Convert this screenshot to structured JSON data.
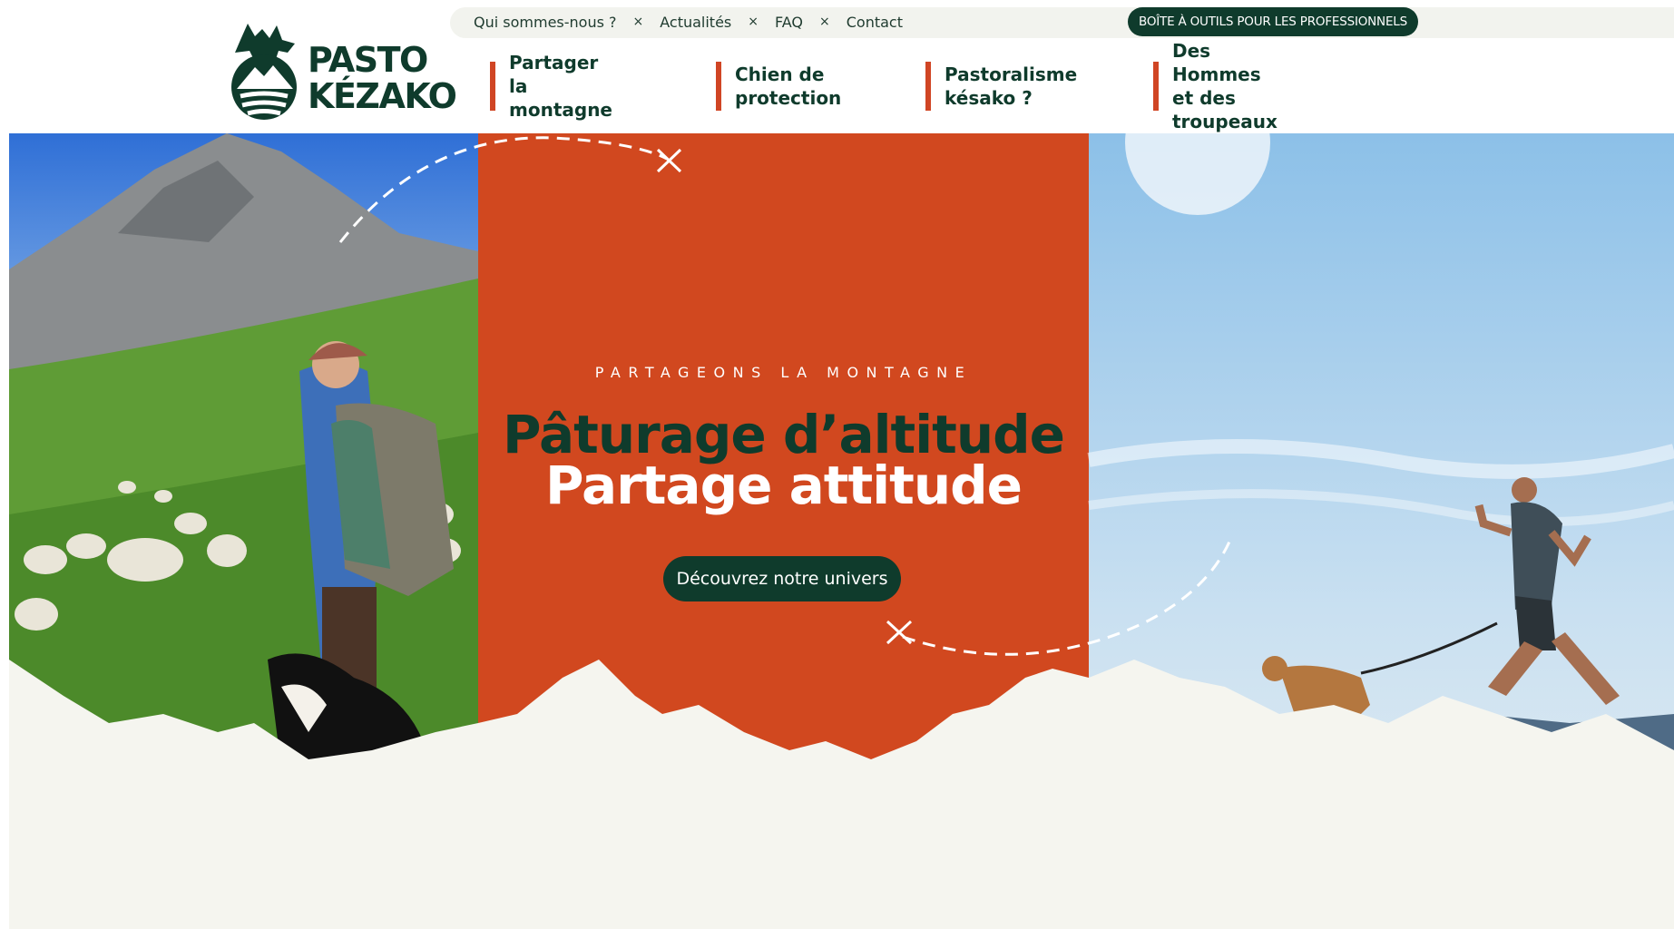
{
  "brand": {
    "name_line1": "PASTO",
    "name_line2": "KÉZAKO",
    "logo_icon": "goat-mountain-logo-icon",
    "primary_color": "#0f3b2c",
    "accent_color": "#d1481f"
  },
  "utility_nav": {
    "links": [
      "Qui sommes-nous ?",
      "Actualités",
      "FAQ",
      "Contact"
    ],
    "separator": "×",
    "pro_button": "BOÎTE À OUTILS POUR LES PROFESSIONNELS"
  },
  "main_nav": {
    "items": [
      {
        "label": "Partager la\nmontagne"
      },
      {
        "label": "Chien de\nprotection"
      },
      {
        "label": "Pastoralisme\nkésako ?"
      },
      {
        "label": "Des Hommes et des\ntroupeaux"
      }
    ]
  },
  "hero": {
    "eyebrow": "PARTAGEONS LA MONTAGNE",
    "headline": "Pâturage d’altitude",
    "subheadline": "Partage attitude",
    "cta": "Découvrez notre univers",
    "left_image": "shepherd-with-sheep-and-dog-photo",
    "right_image": "runner-with-dog-on-mountain-photo"
  }
}
